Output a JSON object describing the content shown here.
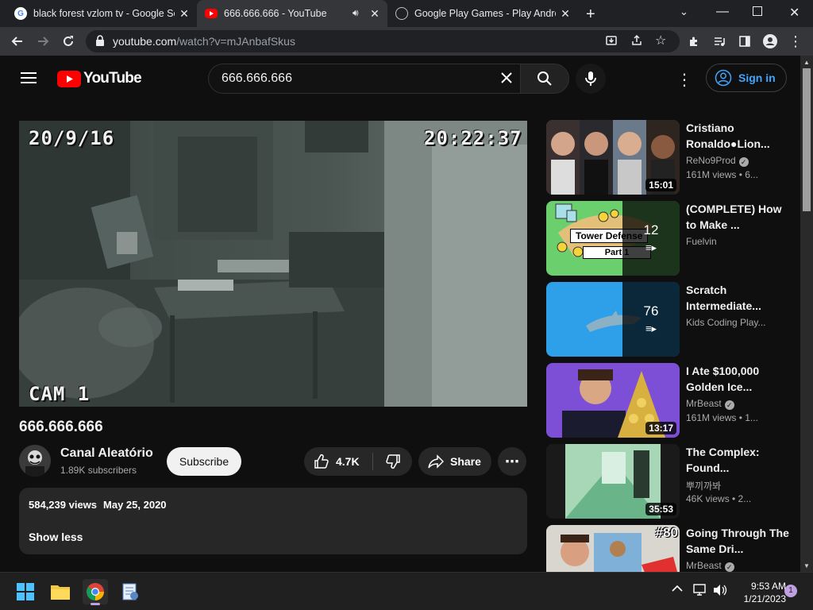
{
  "tabs": [
    {
      "title": "black forest vzlom tv - Google Search",
      "favicon": "google-icon",
      "active": false
    },
    {
      "title": "666.666.666 - YouTube",
      "favicon": "youtube-icon",
      "active": true
    },
    {
      "title": "Google Play Games - Play Android Games",
      "favicon": "globe-icon",
      "active": false
    }
  ],
  "address": {
    "host": "youtube.com",
    "path": "/watch?v=mJAnbafSkus"
  },
  "youtube": {
    "logo_text": "YouTube",
    "search_query": "666.666.666",
    "signin_label": "Sign in"
  },
  "player": {
    "osd_date": "20/9/16",
    "osd_time": "20:22:37",
    "osd_cam": "CAM 1"
  },
  "video": {
    "title": "666.666.666",
    "channel": "Canal Aleatório",
    "subscribers": "1.89K subscribers",
    "subscribe_label": "Subscribe",
    "likes": "4.7K",
    "share_label": "Share",
    "views": "584,239 views",
    "date": "May 25, 2020",
    "show_less": "Show less"
  },
  "recommendations": [
    {
      "title": "Cristiano Ronaldo●Lion...",
      "channel": "ReNo9Prod",
      "verified": true,
      "meta": "161M views • 6...",
      "duration": "15:01"
    },
    {
      "title": "(COMPLETE) How to Make ...",
      "channel": "Fuelvin",
      "verified": false,
      "meta": "",
      "playlist_count": "12",
      "thumb_text_1": "Tower Defense",
      "thumb_text_2": "Part 1"
    },
    {
      "title": "Scratch Intermediate...",
      "channel": "Kids Coding Play...",
      "verified": false,
      "meta": "",
      "playlist_count": "76"
    },
    {
      "title": "I Ate $100,000 Golden Ice...",
      "channel": "MrBeast",
      "verified": true,
      "meta": "161M views • 1...",
      "duration": "13:17"
    },
    {
      "title": "The Complex: Found...",
      "channel": "뿌끼까봐",
      "verified": false,
      "meta": "46K views • 2...",
      "duration": "35:53"
    },
    {
      "title": "Going Through The Same Dri...",
      "channel": "MrBeast",
      "verified": true,
      "meta": "",
      "thumb_text_1": "#80"
    }
  ],
  "taskbar": {
    "time": "9:53 AM",
    "date": "1/21/2023",
    "notifications": "1"
  }
}
